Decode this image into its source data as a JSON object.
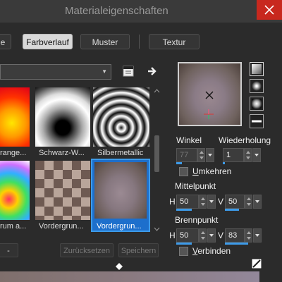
{
  "window": {
    "title": "Materialeigenschaften"
  },
  "tabs": [
    {
      "label": "e"
    },
    {
      "label": "Farbverlauf",
      "active": true
    },
    {
      "label": "Muster"
    },
    {
      "label": "Textur"
    }
  ],
  "gradients": [
    {
      "label": "range..."
    },
    {
      "label": "Schwarz-W..."
    },
    {
      "label": "Silbermetallic"
    },
    {
      "label": "rum a..."
    },
    {
      "label": "Vordergrun..."
    },
    {
      "label": "Vordergrun...",
      "selected": true
    }
  ],
  "buttons": {
    "minus": "-",
    "reset": "Zurücksetzen",
    "save": "Speichern"
  },
  "angle": {
    "label": "Winkel",
    "value": "77",
    "fill": 0.21
  },
  "repeat": {
    "label": "Wiederholung",
    "value": "1",
    "fill": 0.01
  },
  "invert": {
    "label": "Umkehren",
    "underline": "U",
    "rest": "mkehren"
  },
  "center": {
    "label": "Mittelpunkt",
    "h_label": "H",
    "h_value": "50",
    "v_label": "V",
    "v_value": "50",
    "h_fill": 0.5,
    "v_fill": 0.5
  },
  "focus": {
    "label": "Brennpunkt",
    "h_label": "H",
    "h_value": "50",
    "v_label": "V",
    "v_value": "83",
    "h_fill": 0.5,
    "v_fill": 0.83
  },
  "link": {
    "label": "Verbinden",
    "underline": "V",
    "rest": "erbinden"
  },
  "colors": {
    "accent": "#3d9be9",
    "close": "#c8281e"
  }
}
